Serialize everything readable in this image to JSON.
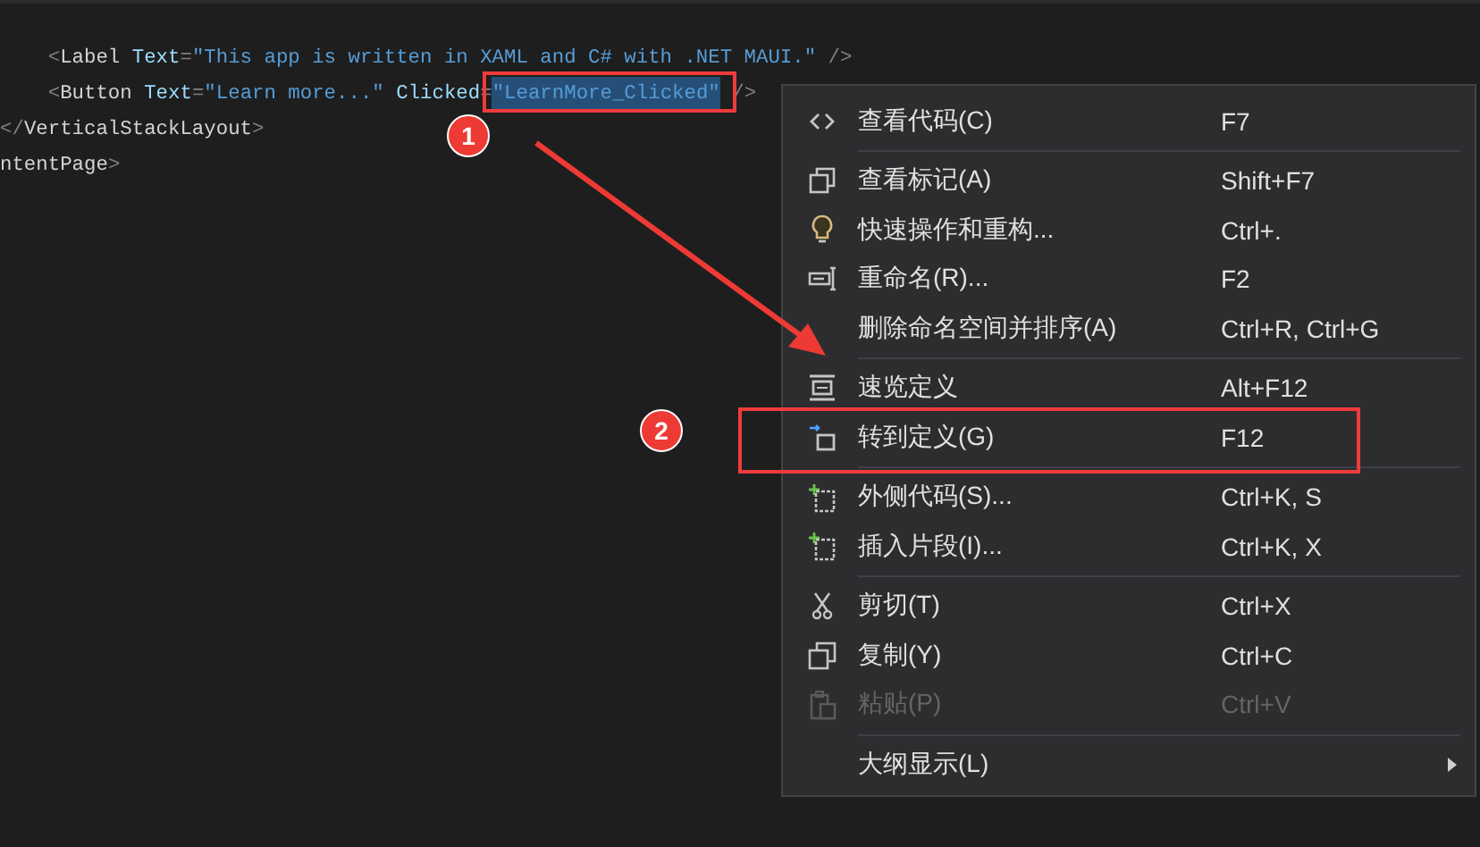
{
  "editor": {
    "lines": [
      {
        "tokens": [
          {
            "kind": "punct",
            "text": "    <",
            "selected": false
          },
          {
            "kind": "element",
            "text": "Label",
            "selected": false
          },
          {
            "kind": "attr",
            "text": " Text",
            "selected": false
          },
          {
            "kind": "punct",
            "text": "=",
            "selected": false
          },
          {
            "kind": "string",
            "text": "\"This app is written in XAML and C# with .NET MAUI.\"",
            "selected": false
          },
          {
            "kind": "punct",
            "text": " />",
            "selected": false
          }
        ]
      },
      {
        "tokens": [
          {
            "kind": "punct",
            "text": "    <",
            "selected": false
          },
          {
            "kind": "element",
            "text": "Button",
            "selected": false
          },
          {
            "kind": "attr",
            "text": " Text",
            "selected": false
          },
          {
            "kind": "punct",
            "text": "=",
            "selected": false
          },
          {
            "kind": "string",
            "text": "\"Learn more...\"",
            "selected": false
          },
          {
            "kind": "attr",
            "text": " Clicked",
            "selected": false
          },
          {
            "kind": "punct",
            "text": "=",
            "selected": false
          },
          {
            "kind": "string",
            "text": "\"LearnMore_Clicked\"",
            "selected": true
          },
          {
            "kind": "punct",
            "text": " />",
            "selected": false
          }
        ]
      },
      {
        "tokens": [
          {
            "kind": "punct",
            "text": "</",
            "selected": false
          },
          {
            "kind": "element",
            "text": "VerticalStackLayout",
            "selected": false
          },
          {
            "kind": "punct",
            "text": ">",
            "selected": false
          }
        ]
      },
      {
        "tokens": [
          {
            "kind": "element",
            "text": "ntentPage",
            "selected": false
          },
          {
            "kind": "punct",
            "text": ">",
            "selected": false
          }
        ]
      }
    ]
  },
  "context_menu": {
    "items": [
      {
        "kind": "item",
        "label": "查看代码(C)",
        "shortcut": "F7",
        "disabled": false,
        "submenu": false
      },
      {
        "kind": "separator"
      },
      {
        "kind": "item",
        "label": "查看标记(A)",
        "shortcut": "Shift+F7",
        "disabled": false,
        "submenu": false
      },
      {
        "kind": "item",
        "label": "快速操作和重构...",
        "shortcut": "Ctrl+.",
        "disabled": false,
        "submenu": false
      },
      {
        "kind": "item",
        "label": "重命名(R)...",
        "shortcut": "F2",
        "disabled": false,
        "submenu": false
      },
      {
        "kind": "item",
        "label": "删除命名空间并排序(A)",
        "shortcut": "Ctrl+R, Ctrl+G",
        "disabled": false,
        "submenu": false
      },
      {
        "kind": "separator"
      },
      {
        "kind": "item",
        "label": "速览定义",
        "shortcut": "Alt+F12",
        "disabled": false,
        "submenu": false
      },
      {
        "kind": "item",
        "label": "转到定义(G)",
        "shortcut": "F12",
        "disabled": false,
        "submenu": false
      },
      {
        "kind": "separator"
      },
      {
        "kind": "item",
        "label": "外侧代码(S)...",
        "shortcut": "Ctrl+K, S",
        "disabled": false,
        "submenu": false
      },
      {
        "kind": "item",
        "label": "插入片段(I)...",
        "shortcut": "Ctrl+K, X",
        "disabled": false,
        "submenu": false
      },
      {
        "kind": "separator"
      },
      {
        "kind": "item",
        "label": "剪切(T)",
        "shortcut": "Ctrl+X",
        "disabled": false,
        "submenu": false
      },
      {
        "kind": "item",
        "label": "复制(Y)",
        "shortcut": "Ctrl+C",
        "disabled": false,
        "submenu": false
      },
      {
        "kind": "item",
        "label": "粘贴(P)",
        "shortcut": "Ctrl+V",
        "disabled": true,
        "submenu": false
      },
      {
        "kind": "separator"
      },
      {
        "kind": "item",
        "label": "大纲显示(L)",
        "disabled": false,
        "submenu": true
      }
    ]
  },
  "annotations": {
    "badges": [
      "1",
      "2"
    ]
  }
}
